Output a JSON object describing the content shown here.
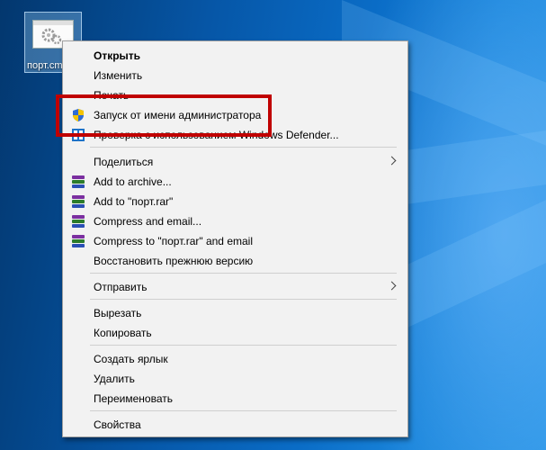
{
  "desktop": {
    "file_label": "порт.cm"
  },
  "menu": {
    "items": [
      {
        "label": "Открыть",
        "bold": true
      },
      {
        "label": "Изменить"
      },
      {
        "label": "Печать"
      },
      {
        "label": "Запуск от имени администратора",
        "icon": "uac-shield-icon"
      },
      {
        "label": "Проверка с использованием Windows Defender...",
        "icon": "windows-defender-icon"
      },
      {
        "label": "Поделиться",
        "submenu": true
      },
      {
        "label": "Add to archive...",
        "icon": "winrar-icon"
      },
      {
        "label": "Add to \"порт.rar\"",
        "icon": "winrar-icon"
      },
      {
        "label": "Compress and email...",
        "icon": "winrar-icon"
      },
      {
        "label": "Compress to \"порт.rar\" and email",
        "icon": "winrar-icon"
      },
      {
        "label": "Восстановить прежнюю версию"
      },
      {
        "label": "Отправить",
        "submenu": true
      },
      {
        "label": "Вырезать"
      },
      {
        "label": "Копировать"
      },
      {
        "label": "Создать ярлык"
      },
      {
        "label": "Удалить"
      },
      {
        "label": "Переименовать"
      },
      {
        "label": "Свойства"
      }
    ]
  },
  "colors": {
    "highlight": "#c00000",
    "menu_background": "#f2f2f2"
  }
}
